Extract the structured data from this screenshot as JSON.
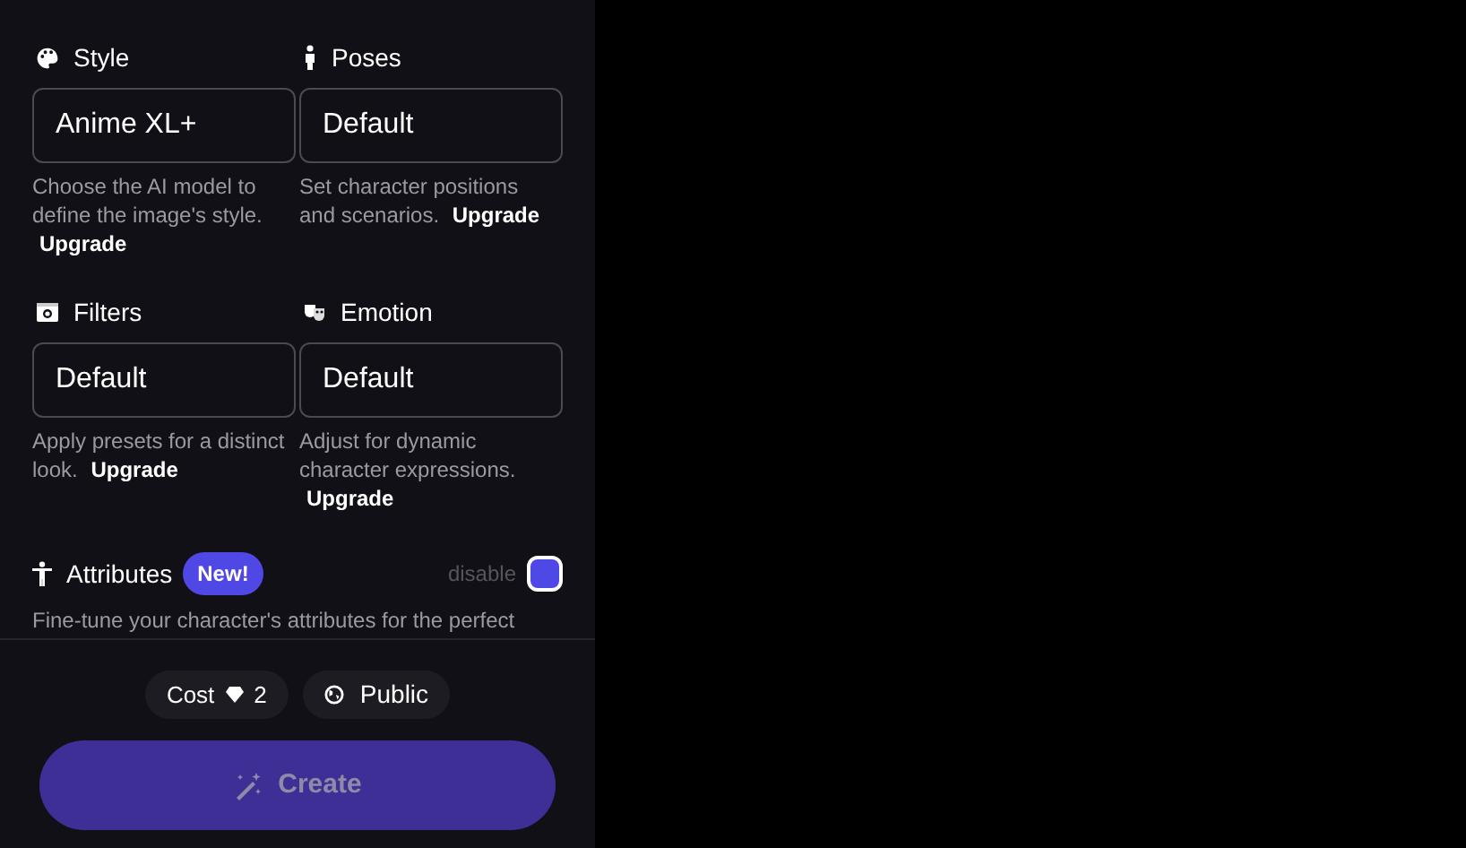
{
  "settings": [
    {
      "kind": "palette",
      "label": "Style",
      "value": "Anime XL+",
      "description": "Choose the AI model to define the image's style.",
      "link": "Upgrade"
    },
    {
      "kind": "person",
      "label": "Poses",
      "value": "Default",
      "description": "Set character positions and scenarios.",
      "link": "Upgrade"
    },
    {
      "kind": "camera",
      "label": "Filters",
      "value": "Default",
      "description": "Apply presets for a distinct look.",
      "link": "Upgrade"
    },
    {
      "kind": "mask",
      "label": "Emotion",
      "value": "Default",
      "description": "Adjust for dynamic character expressions.",
      "link": "Upgrade"
    }
  ],
  "attributes": {
    "label": "Attributes",
    "badge": "New!",
    "toggle_label": "disable",
    "on": true,
    "description": "Fine-tune your character's attributes for the perfect"
  },
  "cost": {
    "label": "Cost",
    "value": "2"
  },
  "visibility": "Public",
  "create_button": {
    "label": "Create",
    "disabled": true
  }
}
